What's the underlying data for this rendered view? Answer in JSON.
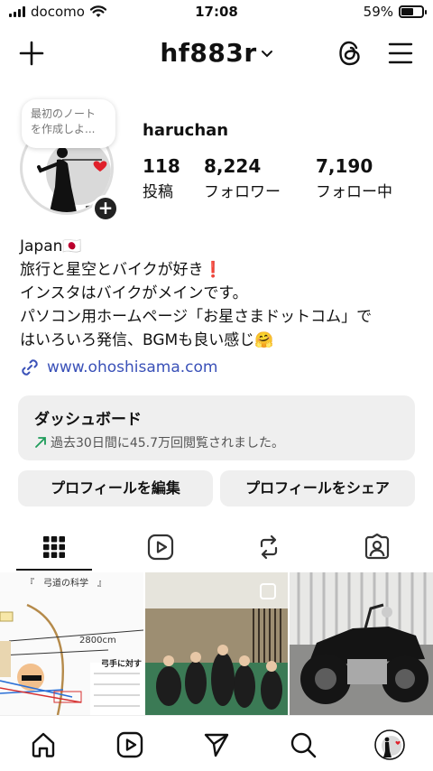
{
  "status_bar": {
    "carrier": "docomo",
    "time": "17:08",
    "battery": "59%",
    "battery_level": 0.59
  },
  "header": {
    "username_title": "hf883r"
  },
  "note": {
    "text_line1": "最初のノート",
    "text_line2": "を作成しよ..."
  },
  "profile": {
    "name": "haruchan",
    "stats": [
      {
        "value": "118",
        "label": "投稿"
      },
      {
        "value": "8,224",
        "label": "フォロワー"
      },
      {
        "value": "7,190",
        "label": "フォロー中"
      }
    ],
    "bio": [
      "Japan🇯🇵",
      "旅行と星空とバイクが好き❗",
      "インスタはバイクがメインです。",
      "パソコン用ホームページ「お星さまドットコム」で",
      "はいろいろ発信、BGMも良い感じ🤗"
    ],
    "link": "www.ohoshisama.com"
  },
  "dashboard": {
    "title": "ダッシュボード",
    "subtitle": "過去30日間に45.7万回閲覧されました。"
  },
  "buttons": {
    "edit": "プロフィールを編集",
    "share": "プロフィールをシェア"
  },
  "thumbnails": {
    "post1_heading": "『　弓道の科学　』",
    "post1_measure": "2800cm",
    "post1_note": "弓手に対す"
  },
  "colors": {
    "link": "#3a51b8",
    "button_bg": "#efefef",
    "trend_up": "#1e9c5a",
    "heart": "#e0202a"
  },
  "icons": {
    "tabs": [
      "grid-icon",
      "reels-icon",
      "reposts-icon",
      "tagged-icon"
    ],
    "nav": [
      "home-icon",
      "reels-icon",
      "send-icon",
      "search-icon",
      "profile-avatar"
    ]
  }
}
